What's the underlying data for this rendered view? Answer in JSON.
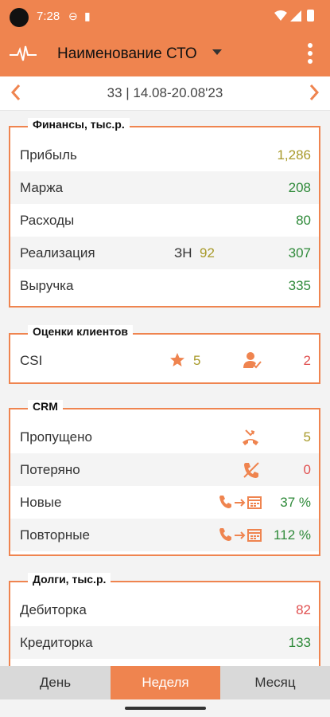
{
  "status": {
    "time": "7:28"
  },
  "appbar": {
    "title": "Наименование СТО"
  },
  "week": {
    "label": "33 | 14.08-20.08'23"
  },
  "finance": {
    "title": "Финансы, тыс.р.",
    "rows": [
      {
        "label": "Прибыль",
        "value": "1,286"
      },
      {
        "label": "Маржа",
        "value": "208"
      },
      {
        "label": "Расходы",
        "value": "80"
      },
      {
        "label": "Реализация",
        "value": "307",
        "zn_label": "ЗН",
        "zn_value": "92"
      },
      {
        "label": "Выручка",
        "value": "335"
      }
    ]
  },
  "ratings": {
    "title": "Оценки клиентов",
    "csi": {
      "label": "CSI",
      "stars": "5",
      "users": "2"
    }
  },
  "crm": {
    "title": "CRM",
    "rows": [
      {
        "label": "Пропущено",
        "value": "5",
        "icon": "missed-call-icon"
      },
      {
        "label": "Потеряно",
        "value": "0",
        "icon": "lost-call-icon"
      },
      {
        "label": "Новые",
        "value": "37 %",
        "icon": "call-to-calendar-icon"
      },
      {
        "label": "Повторные",
        "value": "112 %",
        "icon": "call-to-calendar-icon"
      }
    ]
  },
  "debts": {
    "title": "Долги, тыс.р.",
    "rows": [
      {
        "label": "Дебиторка",
        "value": "82"
      },
      {
        "label": "Кредиторка",
        "value": "133"
      }
    ]
  },
  "tabs": [
    {
      "label": "День",
      "active": false
    },
    {
      "label": "Неделя",
      "active": true
    },
    {
      "label": "Месяц",
      "active": false
    }
  ],
  "colors": {
    "accent": "#ef844f",
    "green": "#2f8a3a",
    "olive": "#a89a2a",
    "red": "#e05050"
  }
}
